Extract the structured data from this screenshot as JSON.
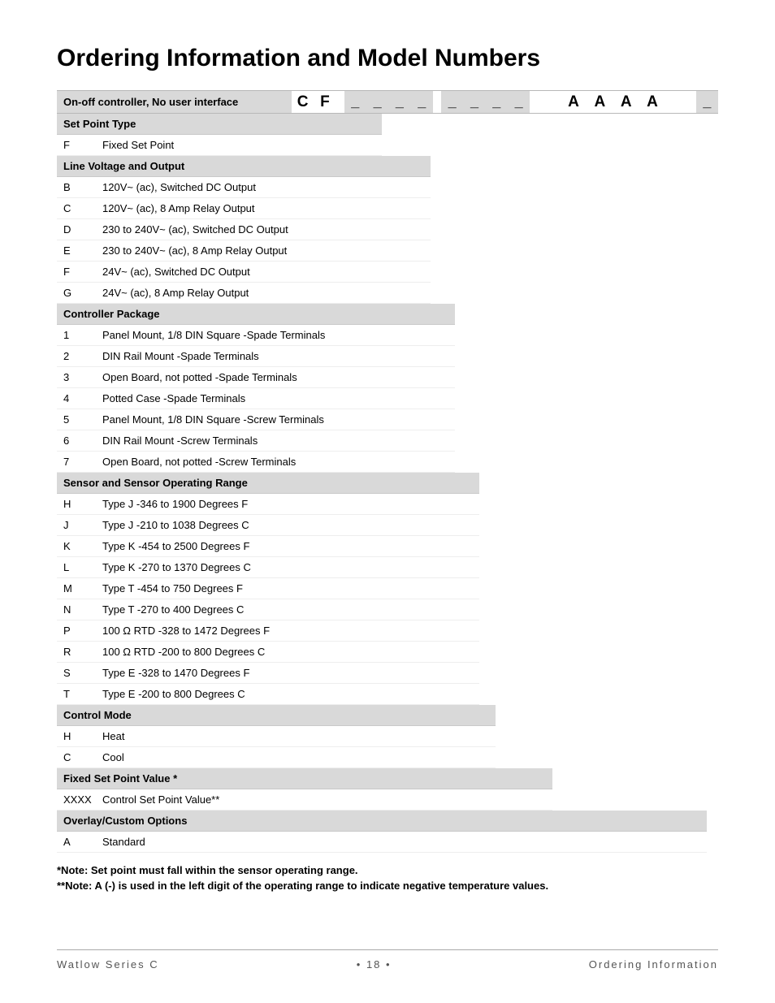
{
  "title": "Ordering Information and Model Numbers",
  "modelRow": {
    "description": "On-off controller, No user interface",
    "fixed": [
      "C",
      "F"
    ],
    "placeholders": [
      "_",
      "_",
      "_",
      "_",
      "_",
      "_",
      "_",
      "_"
    ],
    "overlay": [
      "A",
      "A",
      "A",
      "A"
    ],
    "trail": "_"
  },
  "sections": [
    {
      "header": "Set Point Type",
      "rows": [
        {
          "code": "F",
          "label": "Fixed Set Point"
        }
      ]
    },
    {
      "header": "Line Voltage and Output",
      "rows": [
        {
          "code": "B",
          "label": "120V~ (ac), Switched DC Output"
        },
        {
          "code": "C",
          "label": "120V~ (ac), 8 Amp Relay Output"
        },
        {
          "code": "D",
          "label": "230 to 240V~ (ac), Switched DC Output"
        },
        {
          "code": "E",
          "label": "230 to 240V~ (ac), 8 Amp Relay Output"
        },
        {
          "code": "F",
          "label": "24V~ (ac), Switched DC Output"
        },
        {
          "code": "G",
          "label": "24V~ (ac), 8 Amp Relay Output"
        }
      ]
    },
    {
      "header": "Controller Package",
      "rows": [
        {
          "code": "1",
          "label": "Panel Mount, 1/8 DIN Square -Spade Terminals"
        },
        {
          "code": "2",
          "label": "DIN Rail Mount -Spade Terminals"
        },
        {
          "code": "3",
          "label": "Open Board, not potted -Spade Terminals"
        },
        {
          "code": "4",
          "label": "Potted Case -Spade Terminals"
        },
        {
          "code": "5",
          "label": "Panel Mount, 1/8 DIN Square -Screw Terminals"
        },
        {
          "code": "6",
          "label": "DIN Rail Mount -Screw Terminals"
        },
        {
          "code": "7",
          "label": "Open Board, not potted -Screw Terminals"
        }
      ]
    },
    {
      "header": "Sensor and Sensor Operating Range",
      "rows": [
        {
          "code": "H",
          "label": "Type J  -346 to 1900 Degrees F"
        },
        {
          "code": "J",
          "label": "Type J -210 to 1038 Degrees C"
        },
        {
          "code": "K",
          "label": "Type K -454 to 2500 Degrees F"
        },
        {
          "code": "L",
          "label": "Type K -270 to 1370 Degrees C"
        },
        {
          "code": "M",
          "label": "Type T -454 to 750 Degrees F"
        },
        {
          "code": "N",
          "label": "Type T -270 to 400 Degrees C"
        },
        {
          "code": "P",
          "label": "100 Ω RTD -328 to 1472 Degrees F"
        },
        {
          "code": "R",
          "label": "100 Ω RTD -200 to 800 Degrees C"
        },
        {
          "code": "S",
          "label": "Type E -328 to 1470 Degrees F"
        },
        {
          "code": "T",
          "label": "Type E -200 to 800 Degrees C"
        }
      ]
    },
    {
      "header": "Control Mode",
      "rows": [
        {
          "code": "H",
          "label": "Heat"
        },
        {
          "code": "C",
          "label": "Cool"
        }
      ]
    },
    {
      "header": "Fixed Set Point Value *",
      "rows": [
        {
          "code": "XXXX",
          "label": "Control Set Point Value**"
        }
      ]
    },
    {
      "header": "Overlay/Custom Options",
      "rows": [
        {
          "code": "A",
          "label": "Standard"
        }
      ]
    }
  ],
  "notes": [
    "*Note: Set point must fall within the sensor operating range.",
    "**Note: A (-) is used in the left digit of the operating range to indicate negative temperature values."
  ],
  "footer": {
    "left": "Watlow Series C",
    "mid": "•  18  •",
    "right": "Ordering Information"
  }
}
